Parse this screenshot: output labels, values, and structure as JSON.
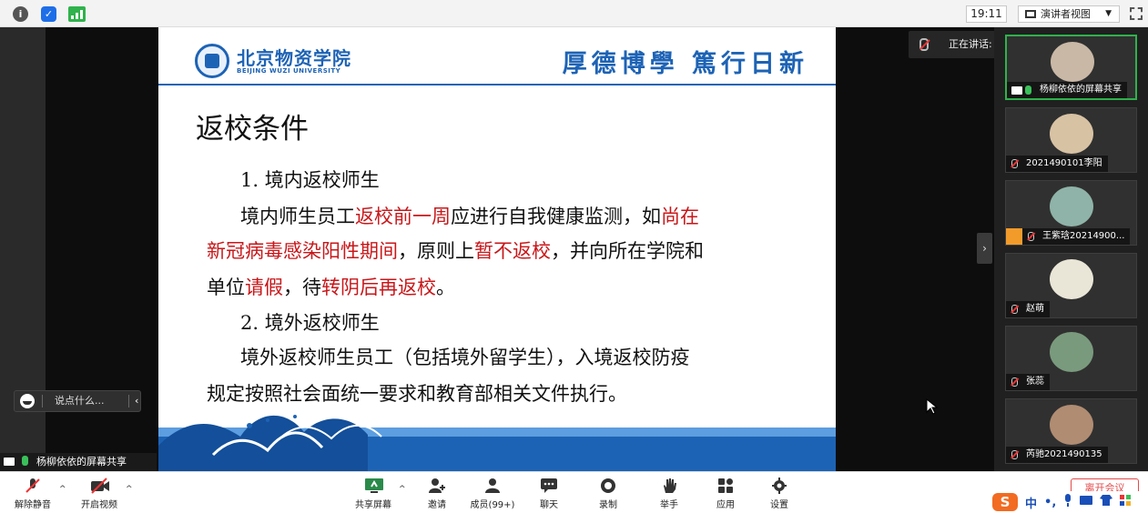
{
  "topbar": {
    "time": "19:11",
    "presenter_view": "演讲者视图"
  },
  "slide": {
    "uni_name": "北京物资学院",
    "uni_en": "BEIJING WUZI UNIVERSITY",
    "motto": "厚德博學 篤行日新",
    "title": "返校条件",
    "l1": "1. 境内返校师生",
    "l2a": "境内师生员工",
    "l2b": "返校前一周",
    "l2c": "应进行自我健康监测，如",
    "l2d": "尚在",
    "l3a": "新冠病毒感染阳性期间",
    "l3b": "，原则上",
    "l3c": "暂不返校",
    "l3d": "，并向所在学院和",
    "l4a": "单位",
    "l4b": "请假",
    "l4c": "，待",
    "l4d": "转阴后再返校",
    "l4e": "。",
    "l5": "2. 境外返校师生",
    "l6": "境外返校师生员工（包括境外留学生），入境返校防疫",
    "l7": "规定按照社会面统一要求和教育部相关文件执行。"
  },
  "chat": {
    "placeholder": "说点什么..."
  },
  "share_label": "杨柳依依的屏幕共享",
  "speaking": "正在讲话: 杨柳依依;",
  "participants": [
    {
      "name": "杨柳依依的屏幕共享",
      "color": "#c9b8a6"
    },
    {
      "name": "2021490101李阳",
      "color": "#d8c2a4"
    },
    {
      "name": "王紫琀20214900...",
      "color": "#8fb3a8"
    },
    {
      "name": "赵萌",
      "color": "#e9e6d8"
    },
    {
      "name": "张蕊",
      "color": "#7a9a7d"
    },
    {
      "name": "芮驰2021490135",
      "color": "#b08c72"
    }
  ],
  "toolbar": {
    "unmute": "解除静音",
    "start_video": "开启视频",
    "share_screen": "共享屏幕",
    "invite": "邀请",
    "members": "成员(99+)",
    "chat": "聊天",
    "record": "录制",
    "raise_hand": "举手",
    "apps": "应用",
    "settings": "设置",
    "leave": "离开会议"
  },
  "ime": {
    "logo": "S",
    "lang": "中",
    "punct": "•,"
  },
  "colors": {
    "accent_blue": "#1d63b5",
    "red_text": "#c8171a",
    "green": "#2fb24c"
  }
}
